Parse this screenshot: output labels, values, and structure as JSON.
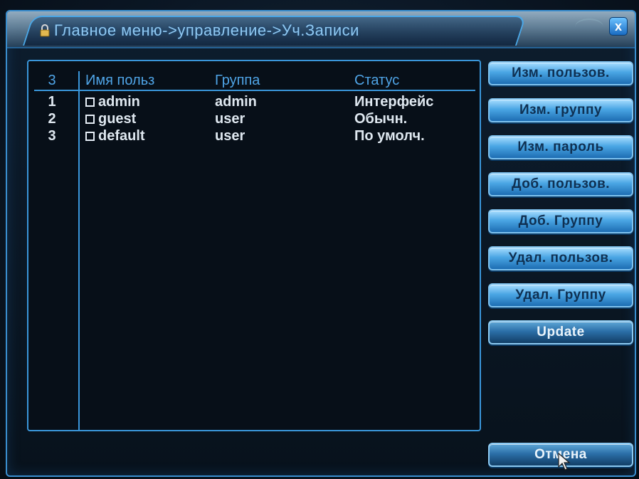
{
  "window": {
    "title": "Главное меню->управление->Уч.Записи",
    "close_label": "x"
  },
  "users_table": {
    "headers": {
      "num": "3",
      "name": "Имя польз",
      "group": "Группа",
      "status": "Статус"
    },
    "rows": [
      {
        "num": "1",
        "name": "admin",
        "group": "admin",
        "status": "Интерфейс"
      },
      {
        "num": "2",
        "name": "guest",
        "group": "user",
        "status": "Обычн."
      },
      {
        "num": "3",
        "name": "default",
        "group": "user",
        "status": "По умолч."
      }
    ]
  },
  "buttons": {
    "edit_user": "Изм. пользов.",
    "edit_group": "Изм. группу",
    "edit_password": "Изм. пароль",
    "add_user": "Доб. пользов.",
    "add_group": "Доб. Группу",
    "delete_user": "Удал. пользов.",
    "delete_group": "Удал. Группу",
    "update": "Update",
    "cancel": "Отмена"
  },
  "colors": {
    "accent": "#3a96da",
    "header_text": "#4fa4e6",
    "row_text": "#dfe8f0",
    "button_light": "#4aa6e4",
    "button_dark": "#2b6fa8"
  },
  "icons": {
    "title": "lock-icon",
    "close": "close-icon",
    "cursor": "mouse-pointer-icon"
  }
}
